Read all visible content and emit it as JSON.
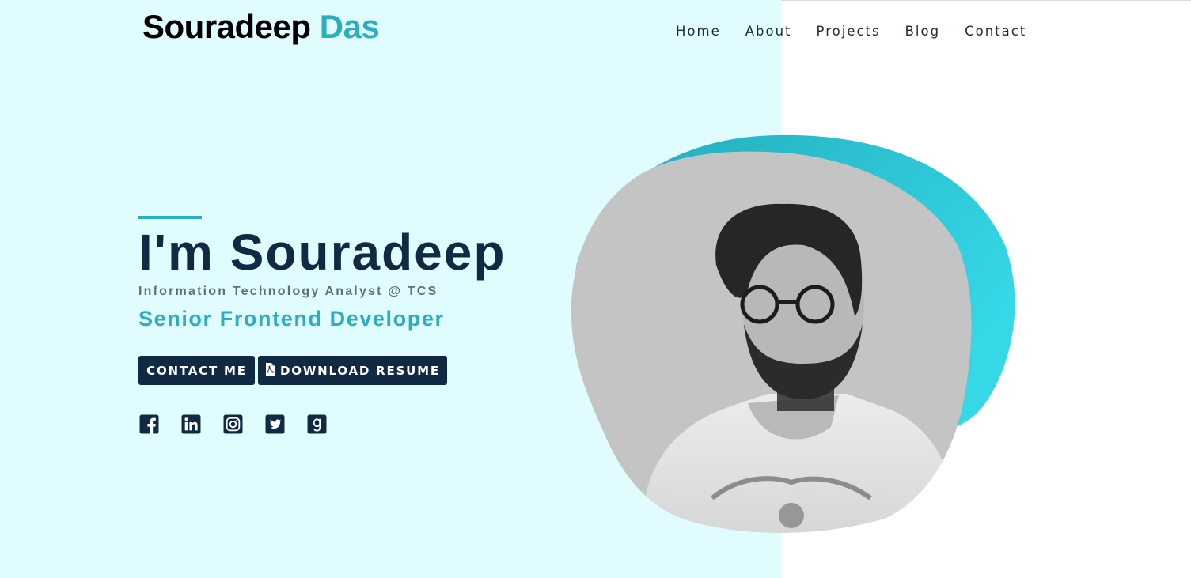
{
  "header": {
    "brand_first": "Souradeep",
    "brand_last": "Das"
  },
  "nav": {
    "items": [
      "Home",
      "About",
      "Projects",
      "Blog",
      "Contact"
    ]
  },
  "hero": {
    "title": "I'm Souradeep",
    "subtitle": "Information Technology Analyst @ TCS",
    "role": "Senior Frontend Developer",
    "contact_button": "CONTACT ME",
    "resume_button": "DOWNLOAD RESUME"
  },
  "socials": {
    "icons": [
      "facebook-icon",
      "linkedin-icon",
      "instagram-icon",
      "twitter-icon",
      "goodreads-icon"
    ]
  },
  "colors": {
    "left_background": "#e0fcff",
    "accent": "#2aaec0",
    "navy": "#102a43",
    "blob_gradient": [
      "#22a9b9",
      "#36d8e8"
    ]
  }
}
